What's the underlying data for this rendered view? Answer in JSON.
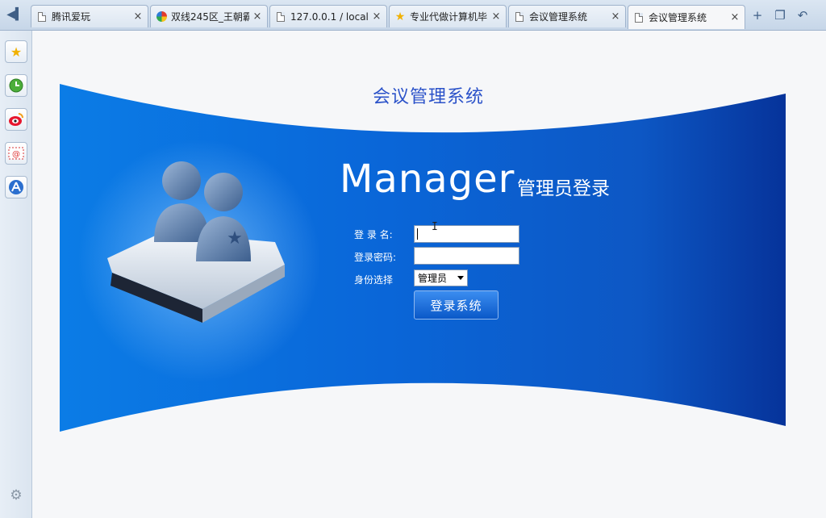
{
  "browser": {
    "tabs": [
      {
        "label": "腾讯爱玩",
        "icon": "document-icon",
        "active": false
      },
      {
        "label": "双线245区_王朝霸",
        "icon": "ie-icon",
        "active": false
      },
      {
        "label": "127.0.0.1 / local",
        "icon": "document-icon",
        "active": false
      },
      {
        "label": "专业代做计算机毕",
        "icon": "star-icon",
        "active": false
      },
      {
        "label": "会议管理系统",
        "icon": "document-icon",
        "active": false
      },
      {
        "label": "会议管理系统",
        "icon": "document-icon",
        "active": true
      }
    ],
    "close_glyph": "×",
    "sidebar": [
      "favorites-star-icon",
      "history-clock-icon",
      "weibo-icon",
      "mail-icon",
      "app-icon"
    ]
  },
  "page": {
    "title": "会议管理系统",
    "hero_title": "Manager",
    "hero_subtitle": "管理员登录",
    "form": {
      "username_label": "登 录 名:",
      "password_label": "登录密码:",
      "role_label": "身份选择",
      "username_value": "",
      "password_value": "",
      "role_selected": "管理员",
      "submit_label": "登录系统"
    }
  },
  "colors": {
    "banner_blue": "#0a5fd4",
    "title_blue": "#2b52c9"
  }
}
